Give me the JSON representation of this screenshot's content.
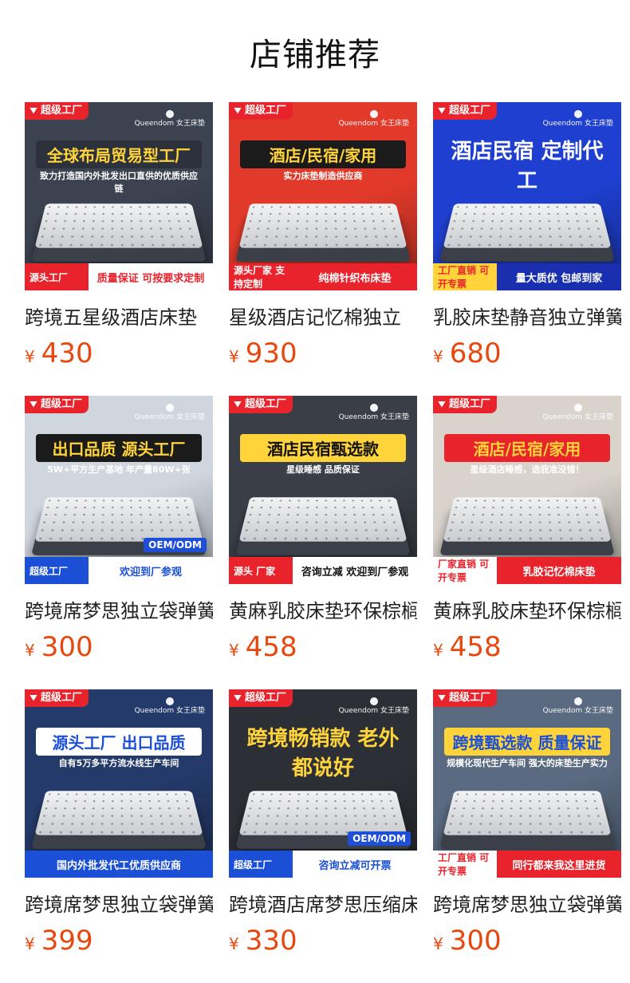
{
  "page": {
    "title": "店铺推荐"
  },
  "products": [
    {
      "name": "跨境五星级酒店床垫",
      "currency": "¥",
      "price": "430",
      "image": {
        "badge": "超级工厂",
        "brand": "Queendom 女王床垫",
        "headline": "全球布局贸易型工厂",
        "subline": "致力打造国内外批发出口直供的优质供应链",
        "footer_left": "源头工厂",
        "footer_right": "质量保证 可按要求定制",
        "colors": {
          "bg": "#3b4250",
          "headline_bg": "rgba(0,0,0,0.25)",
          "headline_fg": "#ffd33a",
          "footer_left_bg": "#e8232b",
          "footer_right_bg": "#ffffff",
          "footer_right_fg": "#e8232b"
        }
      }
    },
    {
      "name": "星级酒店记忆棉独立",
      "currency": "¥",
      "price": "930",
      "image": {
        "badge": "超级工厂",
        "brand": "Queendom 女王床垫",
        "headline": "酒店/民宿/家用",
        "subline": "实力床垫制造供应商",
        "footer_left": "源头厂家 支持定制",
        "footer_right": "纯棉针织布床垫",
        "colors": {
          "bg": "#e23a2a",
          "headline_bg": "#1b1b1b",
          "headline_fg": "#ffd33a",
          "footer_left_bg": "#e8232b",
          "footer_right_bg": "#e8232b",
          "footer_right_fg": "#ffffff"
        }
      }
    },
    {
      "name": "乳胶床垫静音独立弹簧",
      "currency": "¥",
      "price": "680",
      "image": {
        "badge": "超级工厂",
        "brand": "Queendom 女王床垫",
        "headline": "酒店民宿 定制代工",
        "subline": "",
        "footer_left": "工厂直销 可开专票",
        "footer_right": "量大质优 包邮到家",
        "colors": {
          "bg": "#1e3fd0",
          "headline_bg": "transparent",
          "headline_fg": "#ffffff",
          "footer_left_bg": "#ffd33a",
          "footer_right_bg": "#1a2fb0",
          "footer_right_fg": "#ffffff"
        }
      }
    },
    {
      "name": "跨境席梦思独立袋弹簧",
      "currency": "¥",
      "price": "300",
      "image": {
        "badge": "超级工厂",
        "brand": "Queendom 女王床垫",
        "headline": "出口品质 源头工厂",
        "subline": "5W+平方生产基地 年产量80W+张",
        "footer_left": "超级工厂",
        "footer_right": "欢迎到厂参观",
        "oem": "OEM/ODM",
        "colors": {
          "bg": "#cfd6de",
          "headline_bg": "#1b1b1b",
          "headline_fg": "#ffd33a",
          "footer_left_bg": "#1a4fd6",
          "footer_right_bg": "#ffffff",
          "footer_right_fg": "#1a4fd6"
        }
      }
    },
    {
      "name": "黄麻乳胶床垫环保棕榈",
      "currency": "¥",
      "price": "458",
      "image": {
        "badge": "超级工厂",
        "brand": "Queendom 女王床垫",
        "headline": "酒店民宿甄选款",
        "subline": "星级睡感 品质保证",
        "footer_left": "源头 厂家",
        "footer_right": "咨询立减 欢迎到厂参观",
        "colors": {
          "bg": "#3a3f47",
          "headline_bg": "#ffd33a",
          "headline_fg": "#111111",
          "footer_left_bg": "#e8232b",
          "footer_right_bg": "#ffffff",
          "footer_right_fg": "#111111"
        }
      }
    },
    {
      "name": "黄麻乳胶床垫环保棕榈",
      "currency": "¥",
      "price": "458",
      "image": {
        "badge": "超级工厂",
        "brand": "Queendom 女王床垫",
        "headline": "酒店/民宿/家用",
        "subline": "星级酒店睡感，选我准没错！",
        "footer_left": "厂家直销 可开专票",
        "footer_right": "乳胶记忆棉床垫",
        "colors": {
          "bg": "#d9d3cc",
          "headline_bg": "#e8232b",
          "headline_fg": "#ffd33a",
          "footer_left_bg": "#ffffff",
          "footer_right_bg": "#e8232b",
          "footer_right_fg": "#ffffff"
        }
      }
    },
    {
      "name": "跨境席梦思独立袋弹簧",
      "currency": "¥",
      "price": "399",
      "image": {
        "badge": "超级工厂",
        "brand": "Queendom 女王床垫",
        "headline": "源头工厂 出口品质",
        "subline": "自有5万多平方流水线生产车间",
        "footer_left": "",
        "footer_right": "国内外批发代工优质供应商",
        "colors": {
          "bg": "#243a6a",
          "headline_bg": "#ffffff",
          "headline_fg": "#1a4fd6",
          "footer_left_bg": "#1a4fd6",
          "footer_right_bg": "#1a4fd6",
          "footer_right_fg": "#ffffff"
        }
      }
    },
    {
      "name": "跨境酒店席梦思压缩床垫",
      "currency": "¥",
      "price": "330",
      "image": {
        "badge": "超级工厂",
        "brand": "Queendom 女王床垫",
        "headline": "跨境畅销款 老外都说好",
        "subline": "",
        "footer_left": "超级工厂",
        "footer_right": "咨询立减可开票",
        "oem": "OEM/ODM",
        "colors": {
          "bg": "#2c2f36",
          "headline_bg": "transparent",
          "headline_fg": "#ffd33a",
          "footer_left_bg": "#1a4fd6",
          "footer_right_bg": "#ffffff",
          "footer_right_fg": "#1a4fd6"
        }
      }
    },
    {
      "name": "跨境席梦思独立袋弹簧",
      "currency": "¥",
      "price": "300",
      "image": {
        "badge": "超级工厂",
        "brand": "Queendom 女王床垫",
        "headline": "跨境甄选款 质量保证",
        "subline": "规模化现代生产车间 强大的床垫生产实力",
        "footer_left": "工厂直销 可开专票",
        "footer_right": "同行都来我这里进货",
        "colors": {
          "bg": "#5a6a80",
          "headline_bg": "#ffd33a",
          "headline_fg": "#1a4fd6",
          "footer_left_bg": "#ffffff",
          "footer_right_bg": "#e8232b",
          "footer_right_fg": "#ffffff"
        }
      }
    }
  ]
}
